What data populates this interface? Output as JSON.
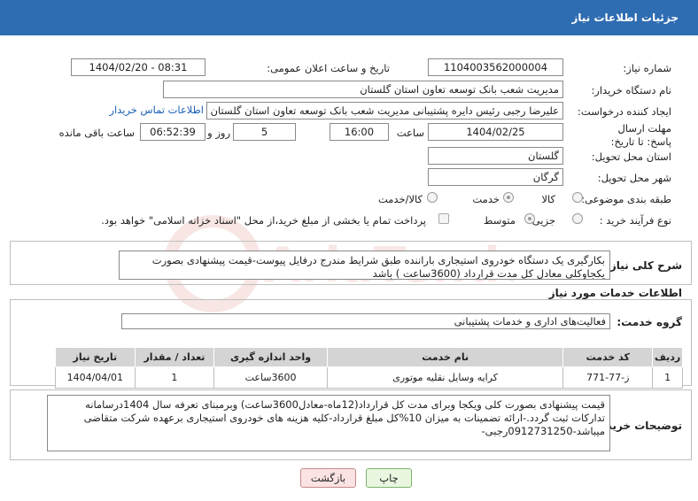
{
  "header": {
    "title": "جزئیات اطلاعات نیاز"
  },
  "form": {
    "need_number_label": "شماره نیاز:",
    "need_number": "1104003562000004",
    "announce_label": "تاریخ و ساعت اعلان عمومی:",
    "announce_value": "1404/02/20 - 08:31",
    "buyer_org_label": "نام دستگاه خریدار:",
    "buyer_org": "مدیریت شعب بانک توسعه تعاون استان گلستان",
    "creator_label": "ایجاد کننده درخواست:",
    "creator": "علیرضا رجبی رئیس دایره پشتیبانی مدیریت شعب بانک توسعه تعاون استان گلستان",
    "contact_link": "اطلاعات تماس خریدار",
    "deadline_label": "مهلت ارسال پاسخ: تا تاریخ:",
    "deadline_date": "1404/02/25",
    "time_label": "ساعت",
    "deadline_time": "16:00",
    "days_value": "5",
    "days_label": "روز و",
    "remaining_value": "06:52:39",
    "remaining_label": "ساعت باقی مانده",
    "province_label": "استان محل تحویل:",
    "province": "گلستان",
    "city_label": "شهر محل تحویل:",
    "city": "گرگان",
    "category_label": "طبقه بندی موضوعی:",
    "category_options": [
      "کالا",
      "خدمت",
      "کالا/خدمت"
    ],
    "process_label": "نوع فرآیند خرید :",
    "process_options": [
      "جزیی",
      "متوسط"
    ],
    "payment_note": "پرداخت تمام یا بخشی از مبلغ خرید،از محل \"اسناد خزانه اسلامی\" خواهد بود."
  },
  "summary": {
    "label": "شرح کلی نیاز:",
    "text": "بکارگیری یک دستگاه خودروی استیجاری باراننده  طبق شرایط مندرج درفایل پیوست-قیمت پیشنهادی  بصورت یکجاوکلی معادل کل مدت  قرارداد (3600ساعت ) باشد"
  },
  "services": {
    "section_title": "اطلاعات خدمات مورد نیاز",
    "group_label": "گروه خدمت:",
    "group_value": "فعالیت‌های اداری و خدمات پشتیبانی",
    "columns": [
      "ردیف",
      "کد خدمت",
      "نام خدمت",
      "واحد اندازه گیری",
      "تعداد / مقدار",
      "تاریخ نیاز"
    ],
    "rows": [
      [
        "1",
        "ز-77-771",
        "کرایه وسایل نقلیه موتوری",
        "3600ساعت",
        "1",
        "1404/04/01"
      ]
    ]
  },
  "buyer_notes": {
    "label": "توضیحات خریدار:",
    "text": "قیمت پیشنهادی بصورت کلی ویکجا وبرای مدت کل قرارداد(12ماه-معادل3600ساعت)  وبرمبنای تعرفه سال 1404درسامانه تدارکات ثبت گردد.-ارائه تضمینات به میزان 10%کل مبلغ قرارداد-کلیه هزینه های خودروی استیجاری برعهده شرکت متقاضی میباشد-0912731250رجبی-"
  },
  "buttons": {
    "print": "چاپ",
    "back": "بازگشت"
  },
  "watermark": {
    "brand": "AriaTender.neT"
  }
}
